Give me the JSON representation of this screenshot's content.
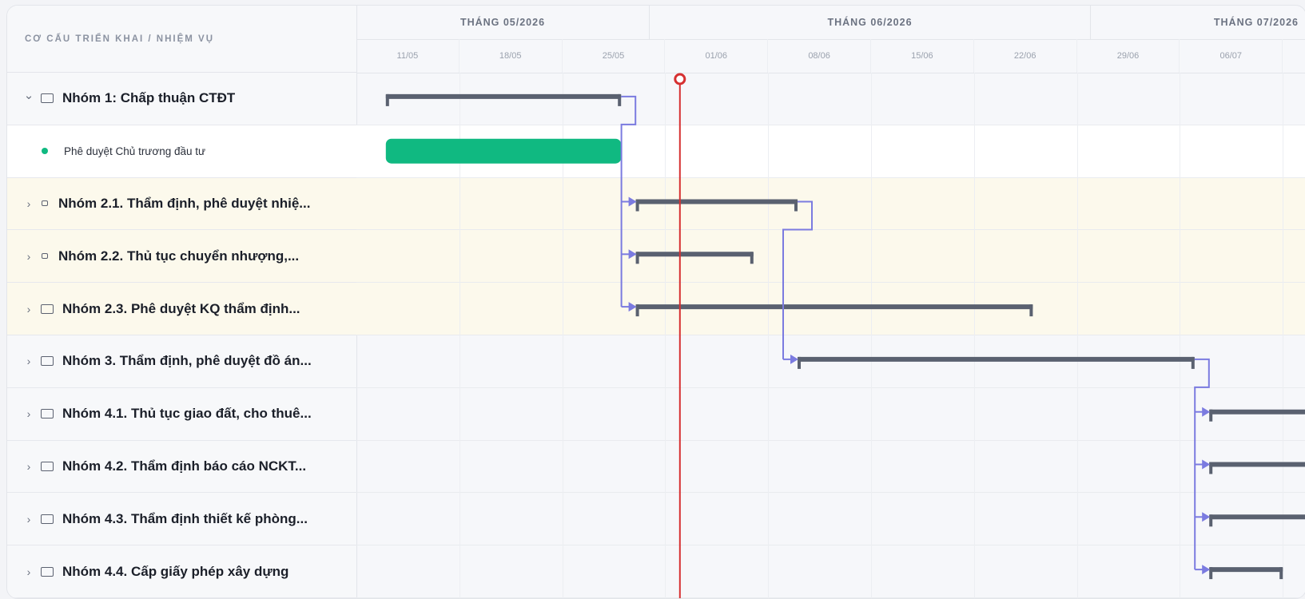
{
  "header": {
    "column_title": "CƠ CẤU TRIỂN KHAI / NHIỆM VỤ"
  },
  "months": [
    {
      "label": "THÁNG 05/2026"
    },
    {
      "label": "THÁNG 06/2026"
    },
    {
      "label": "THÁNG 07/2026"
    }
  ],
  "weeks": [
    "11/05",
    "18/05",
    "25/05",
    "01/06",
    "08/06",
    "15/06",
    "22/06",
    "29/06",
    "06/07"
  ],
  "rows": [
    {
      "type": "group",
      "label": "Nhóm 1: Chấp thuận CTĐT",
      "expanded": true,
      "start": "2026-05-13",
      "end": "2026-05-29"
    },
    {
      "type": "task",
      "label": "Phê duyệt Chủ trương đầu tư",
      "start": "2026-05-13",
      "end": "2026-05-29",
      "color": "#10b981"
    },
    {
      "type": "group",
      "label": "Nhóm 2.1. Thẩm định, phê duyệt nhiệ...",
      "expanded": false,
      "start": "2026-05-30",
      "end": "2026-06-10"
    },
    {
      "type": "group",
      "label": "Nhóm 2.2. Thủ tục chuyển nhượng,...",
      "expanded": false,
      "start": "2026-05-30",
      "end": "2026-06-07"
    },
    {
      "type": "group",
      "label": "Nhóm 2.3. Phê duyệt KQ thẩm định...",
      "expanded": false,
      "start": "2026-05-30",
      "end": "2026-06-26"
    },
    {
      "type": "group",
      "label": "Nhóm 3. Thẩm định, phê duyệt đồ án...",
      "expanded": false,
      "start": "2026-06-10",
      "end": "2026-07-07"
    },
    {
      "type": "group",
      "label": "Nhóm 4.1. Thủ tục giao đất, cho thuê...",
      "expanded": false,
      "start": "2026-07-08",
      "end": "2026-07-15"
    },
    {
      "type": "group",
      "label": "Nhóm 4.2. Thẩm định báo cáo NCKT...",
      "expanded": false,
      "start": "2026-07-08",
      "end": "2026-07-18"
    },
    {
      "type": "group",
      "label": "Nhóm 4.3. Thẩm định thiết kế phòng...",
      "expanded": false,
      "start": "2026-07-08",
      "end": "2026-07-18"
    },
    {
      "type": "group",
      "label": "Nhóm 4.4. Cấp giấy phép xây dựng",
      "expanded": false,
      "start": "2026-07-08",
      "end": "2026-07-13"
    }
  ],
  "today": "2026-06-02",
  "colors": {
    "summary_bar": "#5a6170",
    "task_bar": "#10b981",
    "dependency": "#7b7be0",
    "today_line": "#d63031"
  }
}
